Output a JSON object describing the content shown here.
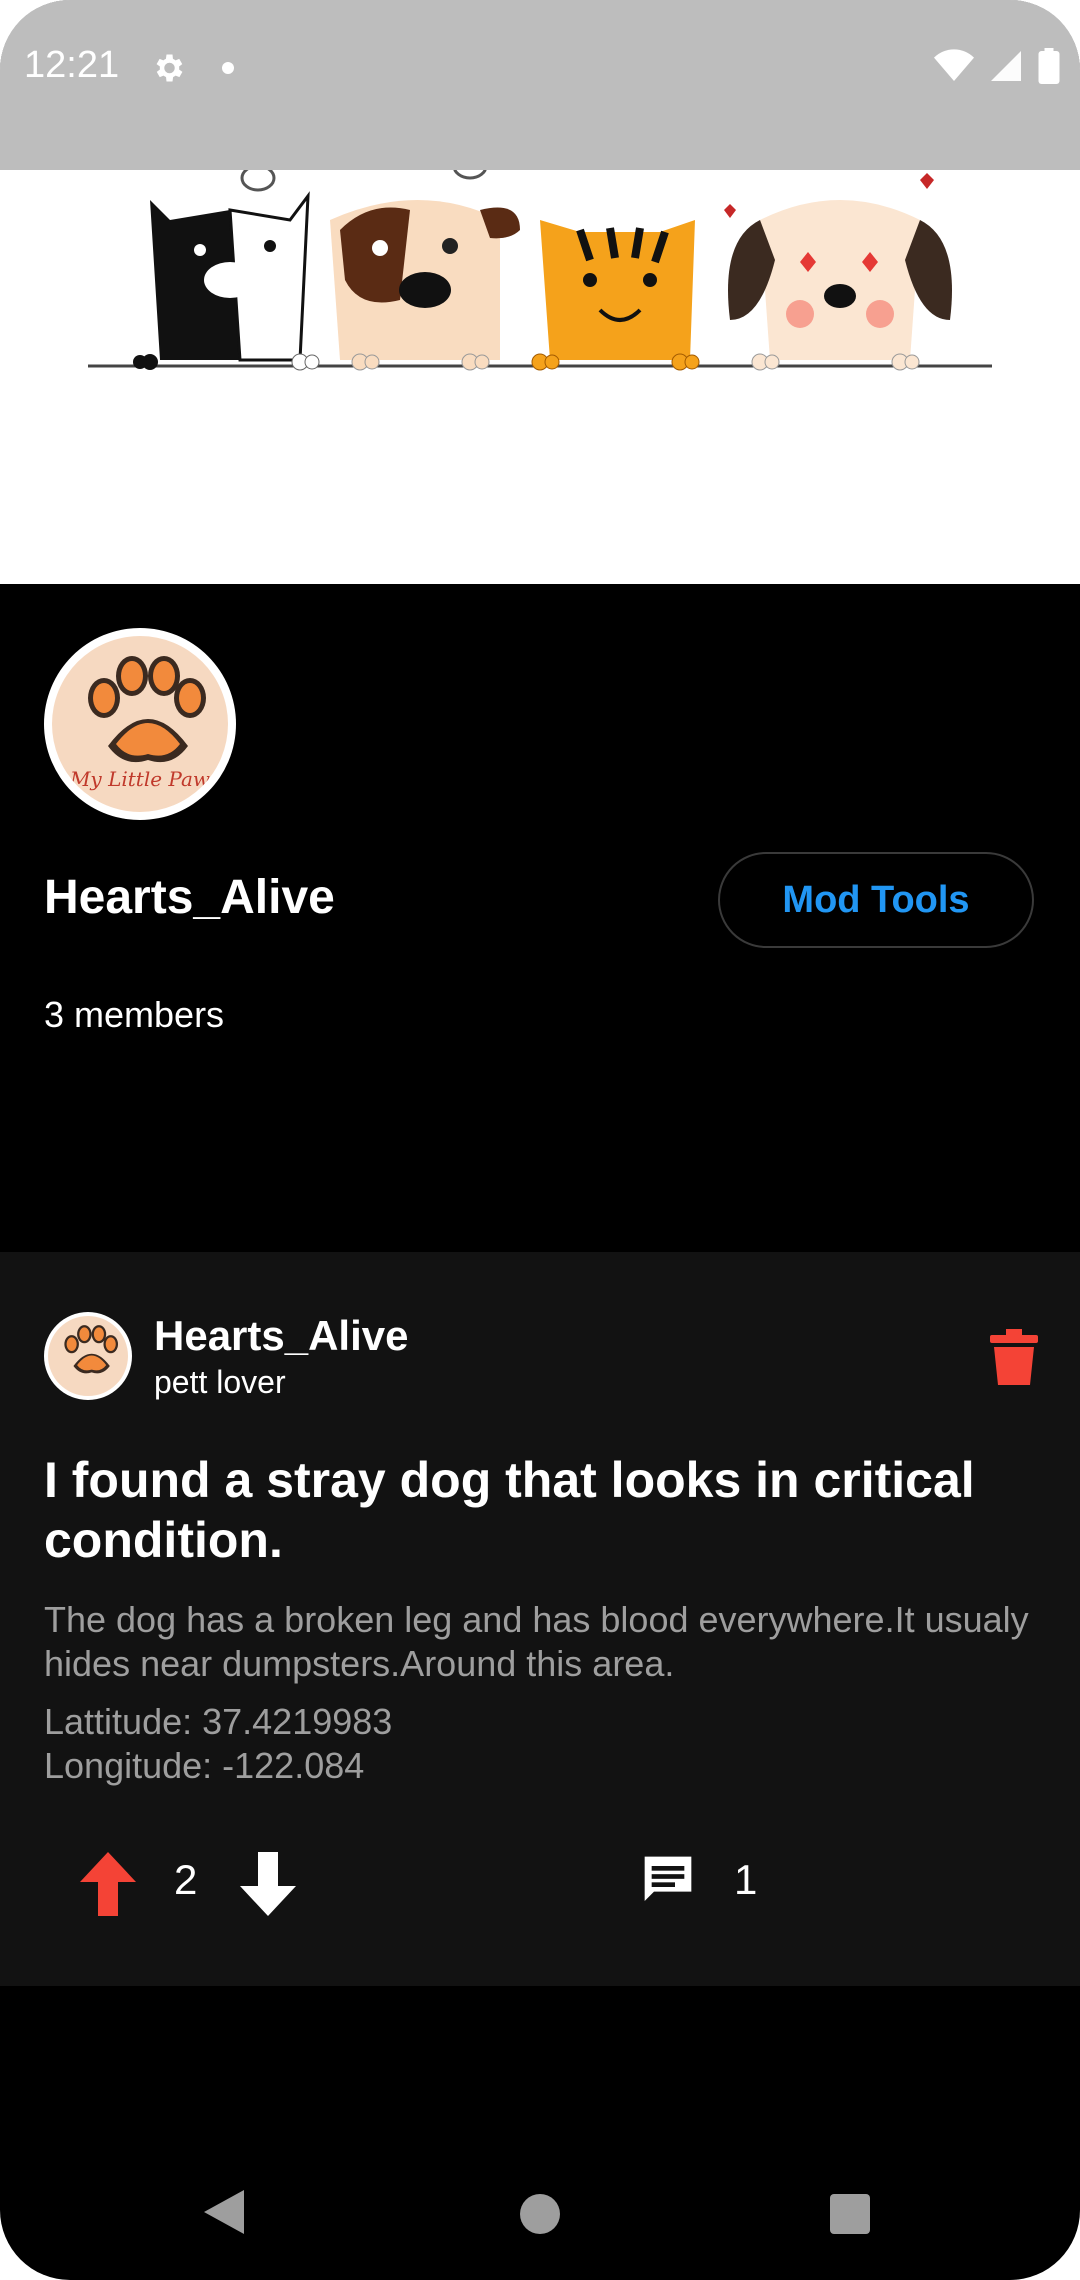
{
  "status_bar": {
    "time": "12:21",
    "icons": [
      "gear-icon",
      "notification-dot-icon",
      "wifi-icon",
      "signal-icon",
      "battery-icon"
    ]
  },
  "banner": {
    "image": "cartoon cats and dogs peeking over a line banner"
  },
  "community": {
    "avatar_icon": "paw-logo",
    "avatar_text": "My Little Paw",
    "name": "Hearts_Alive",
    "mod_tools_label": "Mod Tools",
    "members": "3 members"
  },
  "post": {
    "author": "Hearts_Alive",
    "flair": "pett lover",
    "title": "I found a stray dog that looks in critical condition.",
    "body": "The dog has a broken leg and has blood everywhere.It usualy hides near dumpsters.Around this area.",
    "latitude": "Lattitude: 37.4219983",
    "longitude": "Longitude: -122.084",
    "vote_count": "2",
    "comment_count": "1"
  },
  "colors": {
    "accent_blue": "#2196f3",
    "upvote_red": "#f44336",
    "delete_red": "#f44336",
    "card_bg": "#121212",
    "muted_text": "#9e9e9e"
  }
}
